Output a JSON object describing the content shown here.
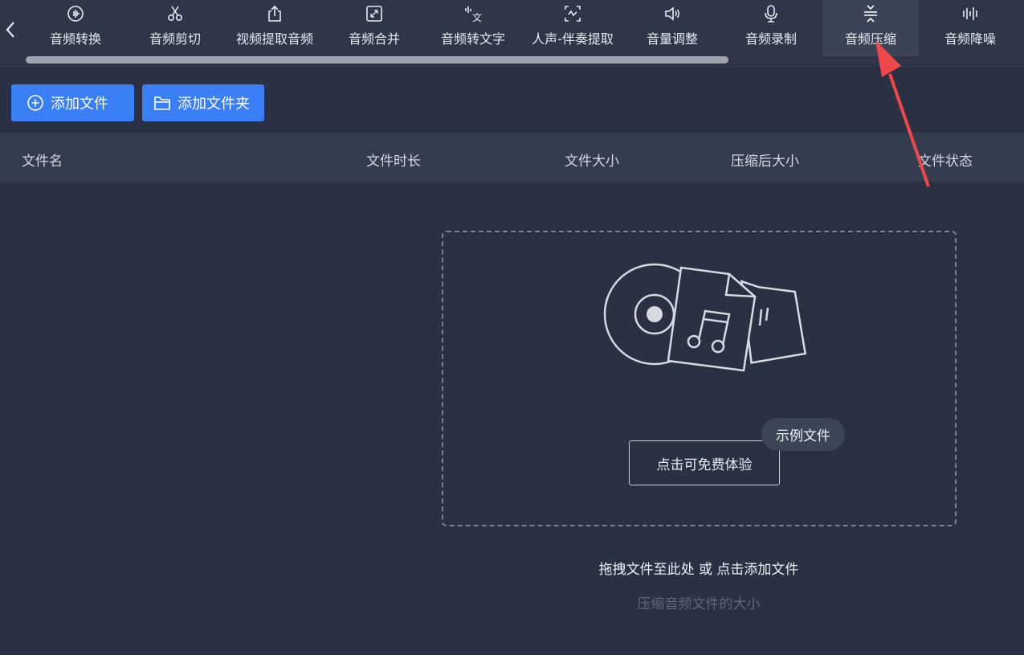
{
  "toolbar": {
    "items": [
      {
        "label": "音频转换",
        "icon": "waveform-circle-icon"
      },
      {
        "label": "音频剪切",
        "icon": "scissors-icon"
      },
      {
        "label": "视频提取音频",
        "icon": "export-icon"
      },
      {
        "label": "音频合并",
        "icon": "merge-icon"
      },
      {
        "label": "音频转文字",
        "icon": "speech-to-text-icon"
      },
      {
        "label": "人声-伴奏提取",
        "icon": "vocal-extract-icon"
      },
      {
        "label": "音量调整",
        "icon": "speaker-icon"
      },
      {
        "label": "音频录制",
        "icon": "microphone-icon"
      },
      {
        "label": "音频压缩",
        "icon": "compress-icon",
        "active": true
      },
      {
        "label": "音频降噪",
        "icon": "noise-reduction-icon"
      }
    ]
  },
  "actions": {
    "add_file": "添加文件",
    "add_folder": "添加文件夹"
  },
  "table": {
    "columns": [
      "文件名",
      "文件时长",
      "文件大小",
      "压缩后大小",
      "文件状态"
    ]
  },
  "dropzone": {
    "try_button": "点击可免费体验",
    "example_badge": "示例文件",
    "hint": "拖拽文件至此处 或 点击添加文件",
    "subhint": "压缩音频文件的大小"
  },
  "colors": {
    "background": "#2a3142",
    "accent": "#3a7ff6",
    "annotation_arrow": "#f0474b"
  }
}
